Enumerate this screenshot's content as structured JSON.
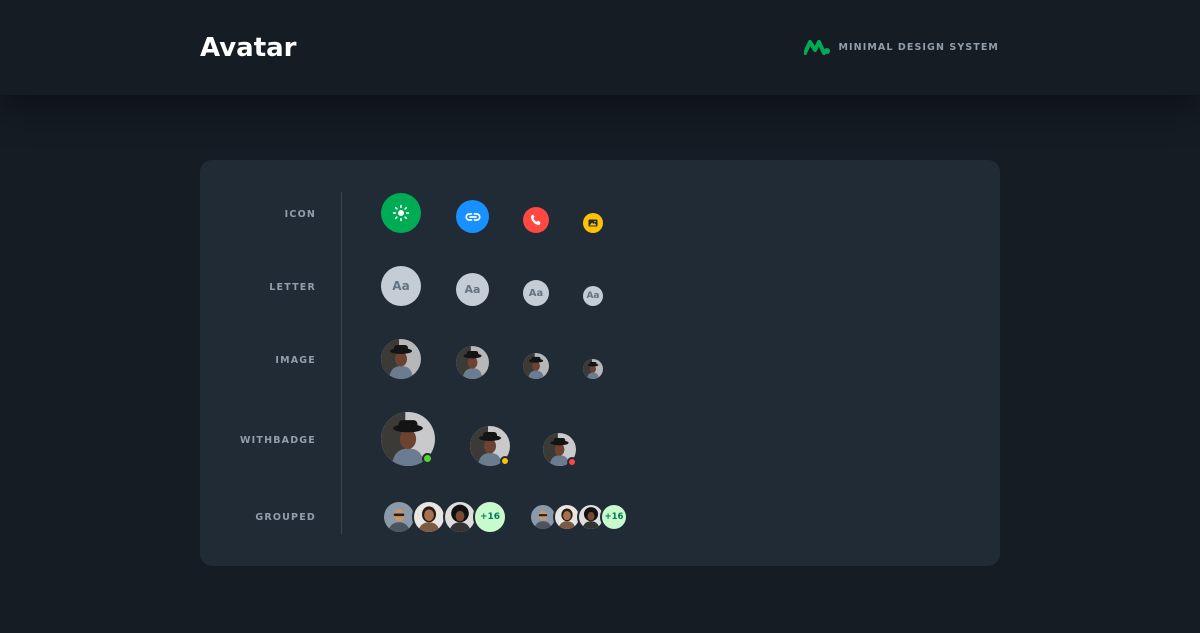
{
  "header": {
    "title": "Avatar",
    "brand_text": "MINIMAL DESIGN SYSTEM",
    "brand_color": "#00ab55"
  },
  "rows": {
    "icon": "ICON",
    "letter": "LETTER",
    "image": "IMAGE",
    "withbadge": "WITHBADGE",
    "grouped": "GROUPED"
  },
  "icon_avatars": [
    {
      "icon": "sun-icon",
      "color": "#00ab55"
    },
    {
      "icon": "link-icon",
      "color": "#1890ff"
    },
    {
      "icon": "phone-icon",
      "color": "#ff4842"
    },
    {
      "icon": "image-icon",
      "color": "#ffc107"
    }
  ],
  "letter_avatar_text": "Aa",
  "badge_colors": [
    "#54d62c",
    "#ffc107",
    "#ff4842"
  ],
  "group_more_label": "+16",
  "group_more_label_small": "+16"
}
